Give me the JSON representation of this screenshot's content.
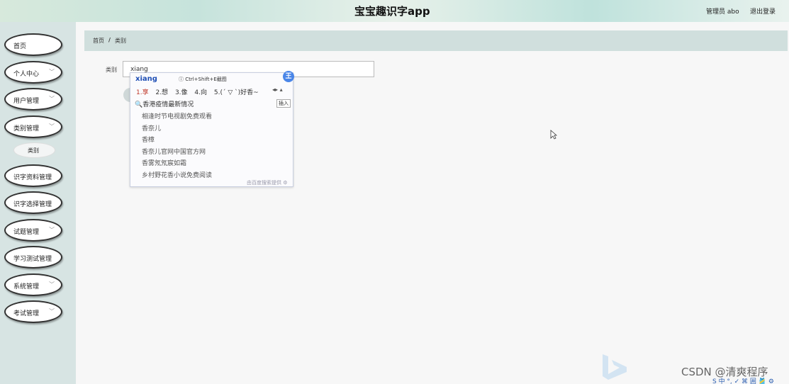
{
  "header": {
    "title": "宝宝趣识字app",
    "admin_label": "管理员 abo",
    "logout_label": "退出登录"
  },
  "sidebar": {
    "items": [
      {
        "label": "首页",
        "has_dropdown": false
      },
      {
        "label": "个人中心",
        "has_dropdown": true
      },
      {
        "label": "用户管理",
        "has_dropdown": true
      },
      {
        "label": "类别管理",
        "has_dropdown": true
      },
      {
        "label": "识字资料管理",
        "has_dropdown": true
      },
      {
        "label": "识字选择管理",
        "has_dropdown": true
      },
      {
        "label": "试题管理",
        "has_dropdown": true
      },
      {
        "label": "学习测试管理",
        "has_dropdown": true
      },
      {
        "label": "系统管理",
        "has_dropdown": true
      },
      {
        "label": "考试管理",
        "has_dropdown": true
      }
    ],
    "sub_item": "类别"
  },
  "breadcrumb": {
    "home": "首页",
    "separator": "/",
    "current": "类别"
  },
  "form": {
    "label": "类别",
    "value": "xiang"
  },
  "ime": {
    "pinyin": "xiang",
    "hint": "ⓘ Ctrl+Shift+E截图",
    "logo": "王",
    "candidates": [
      "1.享",
      "2.想",
      "3.像",
      "4.向",
      "5.(ˊ ▽ ˋ)好香~"
    ],
    "arrows": "◂▸ ▴",
    "search_text": "香港疫情最新情况",
    "insert_label": "插入",
    "suggestions": [
      "相逢时节电视剧免费观看",
      "香奈儿",
      "香樟",
      "香奈儿官网中国官方网",
      "香雾氖氖宸如霜",
      "乡村野花香小说免费阅读"
    ],
    "footer": "由百度搜索提供 ⚙"
  },
  "watermark": "CSDN @清爽程序",
  "tray": "S 中 °, ✓ ⌘ 囲 🎽 ⚙",
  "icons": {
    "chevron": "chevron-down-icon",
    "search": "search-icon",
    "cursor": "mouse-cursor-icon"
  }
}
